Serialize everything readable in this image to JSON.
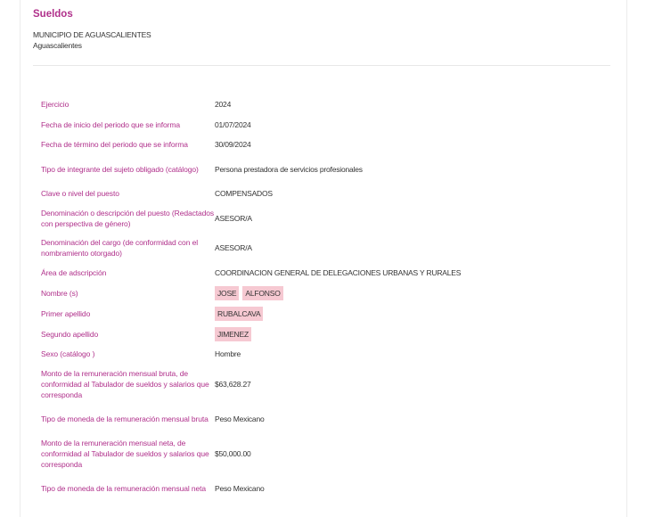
{
  "header": {
    "title": "Sueldos",
    "entity": "MUNICIPIO DE AGUASCALIENTES",
    "state": "Aguascalientes"
  },
  "fields": {
    "ejercicio": {
      "label": "Ejercicio",
      "value": "2024"
    },
    "fecha_inicio": {
      "label": "Fecha de inicio del periodo que se informa",
      "value": "01/07/2024"
    },
    "fecha_termino": {
      "label": "Fecha de término del periodo que se informa",
      "value": "30/09/2024"
    },
    "tipo_integrante": {
      "label": "Tipo de integrante del sujeto obligado (catálogo)",
      "value": "Persona prestadora de servicios profesionales"
    },
    "clave_puesto": {
      "label": "Clave o nivel del puesto",
      "value": "COMPENSADOS"
    },
    "denominacion_puesto": {
      "label": "Denominación o descripción del puesto (Redactados con perspectiva de género)",
      "value": "ASESOR/A"
    },
    "denominacion_cargo": {
      "label": "Denominación del cargo (de conformidad con el nombramiento otorgado)",
      "value": "ASESOR/A"
    },
    "area": {
      "label": "Área de adscripción",
      "value": "COORDINACION GENERAL DE DELEGACIONES URBANAS Y RURALES"
    },
    "nombre": {
      "label": "Nombre (s)",
      "tags": [
        "JOSE",
        "ALFONSO"
      ]
    },
    "primer_apellido": {
      "label": "Primer apellido",
      "tags": [
        "RUBALCAVA"
      ]
    },
    "segundo_apellido": {
      "label": "Segundo apellido",
      "tags": [
        "JIMENEZ"
      ]
    },
    "sexo": {
      "label": "Sexo (catálogo )",
      "value": "Hombre"
    },
    "monto_bruta": {
      "label": "Monto de la remuneración mensual bruta, de conformidad al Tabulador de sueldos y salarios que corresponda",
      "value": "$63,628.27"
    },
    "moneda_bruta": {
      "label": "Tipo de moneda de la remuneración mensual bruta",
      "value": "Peso Mexicano"
    },
    "monto_neta": {
      "label": "Monto de la remuneración mensual neta, de conformidad al Tabulador de sueldos y salarios que corresponda",
      "value": "$50,000.00"
    },
    "moneda_neta": {
      "label": "Tipo de moneda de la remuneración mensual neta",
      "value": "Peso Mexicano"
    }
  },
  "colors": {
    "label": "#b0308b",
    "value": "#333333",
    "highlight": "#f6c9d2"
  }
}
